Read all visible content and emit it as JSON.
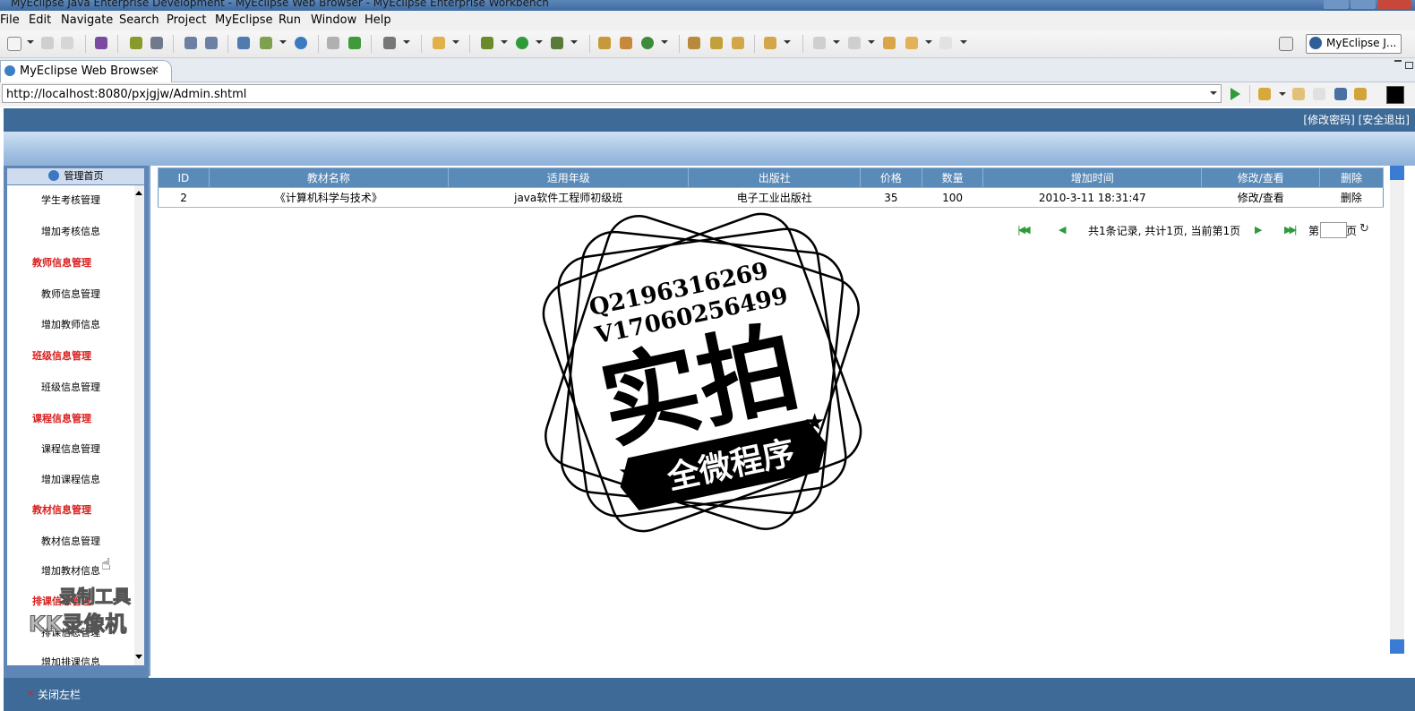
{
  "window": {
    "title": "MyEclipse Java Enterprise Development - MyEclipse Web Browser - MyEclipse Enterprise Workbench"
  },
  "menu": [
    "File",
    "Edit",
    "Navigate",
    "Search",
    "Project",
    "MyEclipse",
    "Run",
    "Window",
    "Help"
  ],
  "perspective": {
    "label": "MyEclipse J..."
  },
  "editor_tab": {
    "label": "MyEclipse Web Browser"
  },
  "browser": {
    "url": "http://localhost:8080/pxjgjw/Admin.shtml"
  },
  "header": {
    "change_password": "[修改密码]",
    "logout": "[安全退出]"
  },
  "sidebar": {
    "title": "管理首页",
    "items": [
      {
        "label": "学生考核管理",
        "category": false
      },
      {
        "label": "增加考核信息",
        "category": false
      },
      {
        "label": "教师信息管理",
        "category": true
      },
      {
        "label": "教师信息管理",
        "category": false
      },
      {
        "label": "增加教师信息",
        "category": false
      },
      {
        "label": "班级信息管理",
        "category": true
      },
      {
        "label": "班级信息管理",
        "category": false
      },
      {
        "label": "课程信息管理",
        "category": true
      },
      {
        "label": "课程信息管理",
        "category": false
      },
      {
        "label": "增加课程信息",
        "category": false
      },
      {
        "label": "教材信息管理",
        "category": true
      },
      {
        "label": "教材信息管理",
        "category": false
      },
      {
        "label": "增加教材信息",
        "category": false
      },
      {
        "label": "排课信息管理",
        "category": true
      },
      {
        "label": "排课信息管理",
        "category": false
      },
      {
        "label": "增加排课信息",
        "category": false
      }
    ]
  },
  "table": {
    "headers": [
      "ID",
      "教材名称",
      "适用年级",
      "出版社",
      "价格",
      "数量",
      "增加时间",
      "修改/查看",
      "删除"
    ],
    "rows": [
      [
        "2",
        "《计算机科学与技术》",
        "java软件工程师初级班",
        "电子工业出版社",
        "35",
        "100",
        "2010-3-11 18:31:47",
        "修改/查看",
        "删除"
      ]
    ]
  },
  "pager": {
    "summary": "共1条记录, 共计1页, 当前第1页",
    "page_prefix": "第",
    "page_suffix": "页"
  },
  "footer": {
    "close_sidebar": "关闭左栏"
  },
  "stamp": {
    "line1": "Q2196316269",
    "line2": "V17060256499",
    "big": "实拍",
    "ribbon": "全微程序"
  },
  "watermark": {
    "line1": "录制工具",
    "line2": "KK录像机"
  },
  "colors": {
    "header_blue": "#3e6a97",
    "table_head": "#5a8ab8",
    "category_red": "#d9201f"
  }
}
